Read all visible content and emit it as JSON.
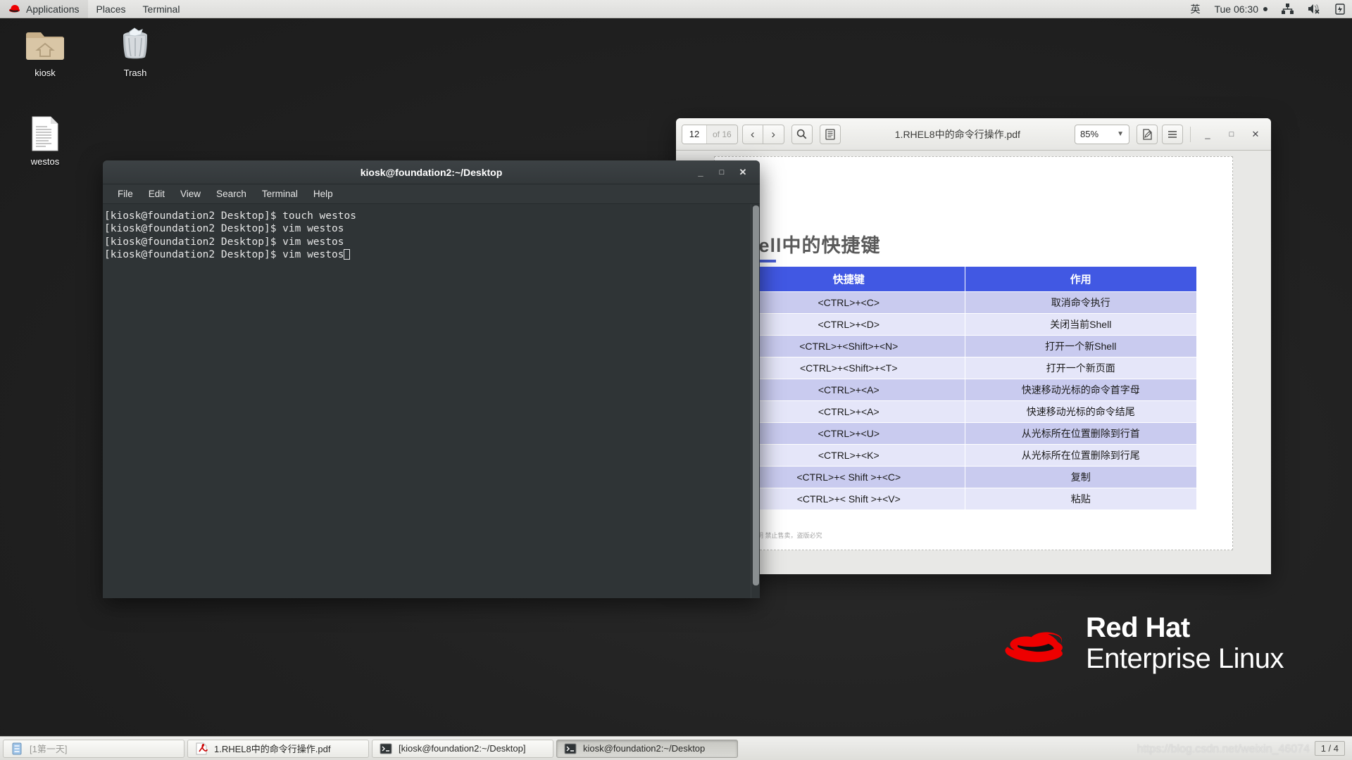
{
  "top_panel": {
    "logo_icon": "redhat-logo-icon",
    "menus": [
      "Applications",
      "Places",
      "Terminal"
    ],
    "input_method": "英",
    "clock": "Tue 06:30",
    "tray": [
      "network-icon",
      "volume-muted-icon",
      "battery-icon"
    ]
  },
  "desktop": {
    "icons": [
      {
        "name": "kiosk",
        "icon": "home-folder-icon"
      },
      {
        "name": "Trash",
        "icon": "trash-icon"
      },
      {
        "name": "westos",
        "icon": "text-document-icon"
      }
    ],
    "brand_line1": "Red Hat",
    "brand_line2": "Enterprise Linux"
  },
  "terminal": {
    "title": "kiosk@foundation2:~/Desktop",
    "menus": [
      "File",
      "Edit",
      "View",
      "Search",
      "Terminal",
      "Help"
    ],
    "window_buttons": {
      "minimize": "_",
      "maximize": "□",
      "close": "✕"
    },
    "lines": [
      "[kiosk@foundation2 Desktop]$ touch westos",
      "[kiosk@foundation2 Desktop]$ vim westos",
      "[kiosk@foundation2 Desktop]$ vim westos",
      "[kiosk@foundation2 Desktop]$ vim westos"
    ]
  },
  "pdf_viewer": {
    "page_current": "12",
    "page_total": "of 16",
    "title": "1.RHEL8中的命令行操作.pdf",
    "zoom": "85%",
    "buttons": {
      "prev": "‹",
      "next": "›",
      "search": "search-icon",
      "outline": "sidebar-icon",
      "annotate": "annotation-icon",
      "menu": "hamburger-menu-icon",
      "minimize": "_",
      "maximize": "□",
      "close": "✕"
    },
    "slide": {
      "title": "Shell中的快捷键",
      "columns": [
        "快捷键",
        "作用"
      ],
      "rows": [
        [
          "<CTRL>+<C>",
          "取消命令执行"
        ],
        [
          "<CTRL>+<D>",
          "关闭当前Shell"
        ],
        [
          "<CTRL>+<Shift>+<N>",
          "打开一个新Shell"
        ],
        [
          "<CTRL>+<Shift>+<T>",
          "打开一个新页面"
        ],
        [
          "<CTRL>+<A>",
          "快速移动光标的命令首字母"
        ],
        [
          "<CTRL>+<A>",
          "快速移动光标的命令结尾"
        ],
        [
          "<CTRL>+<U>",
          "从光标所在位置删除到行首"
        ],
        [
          "<CTRL>+<K>",
          "从光标所在位置删除到行尾"
        ],
        [
          "<CTRL>+< Shift >+<C>",
          "复制"
        ],
        [
          "<CTRL>+< Shift >+<V>",
          "粘贴"
        ]
      ],
      "footer": "源技术中心-李天明  禁止售卖，盗版必究"
    }
  },
  "taskbar": {
    "items": [
      {
        "label": "[1第一天]",
        "icon": "document-icon",
        "active": false
      },
      {
        "label": "1.RHEL8中的命令行操作.pdf",
        "icon": "evince-pdf-icon",
        "active": false
      },
      {
        "label": "[kiosk@foundation2:~/Desktop]",
        "icon": "terminal-icon",
        "active": false
      },
      {
        "label": "kiosk@foundation2:~/Desktop",
        "icon": "terminal-icon",
        "active": true
      }
    ],
    "workspace": "1 / 4",
    "watermark": "https://blog.csdn.net/weixin_46074"
  },
  "colors": {
    "accent_blue": "#4158e3",
    "redhat_red": "#ee0000",
    "terminal_bg": "#2f3436",
    "panel_bg": "#e9e9e7"
  }
}
